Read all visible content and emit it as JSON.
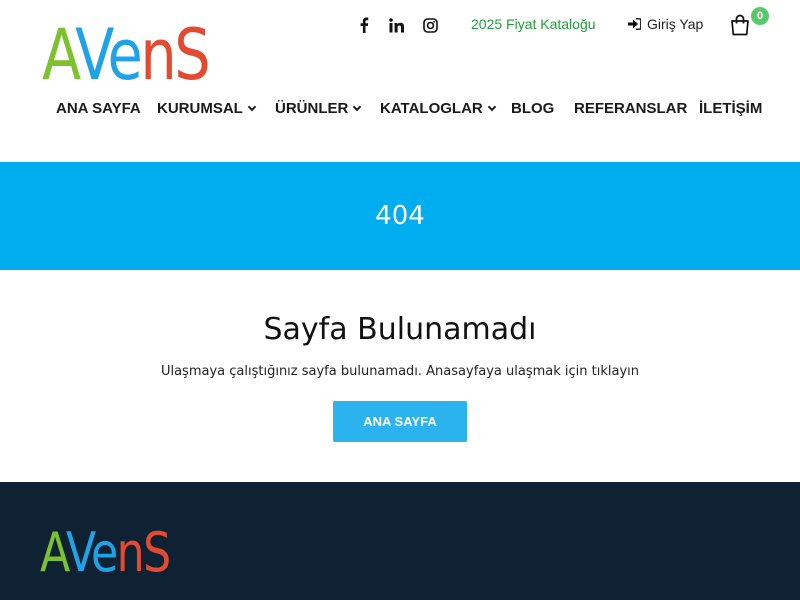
{
  "brand": {
    "logo_parts": [
      "A",
      "Ve",
      "nS"
    ],
    "colors": {
      "green": "#7dc22e",
      "blue": "#1fa3e6",
      "red": "#e44a2f"
    }
  },
  "topbar": {
    "social": [
      {
        "icon": "facebook-icon",
        "glyph": "f"
      },
      {
        "icon": "linkedin-icon",
        "glyph": "in"
      },
      {
        "icon": "instagram-icon",
        "glyph": ""
      }
    ],
    "catalog_link": "2025 Fiyat Kataloğu",
    "login_label": "Giriş Yap",
    "cart_count": "0"
  },
  "nav": {
    "items": [
      {
        "label": "ANA SAYFA",
        "has_dropdown": false
      },
      {
        "label": "KURUMSAL",
        "has_dropdown": true
      },
      {
        "label": "ÜRÜNLER",
        "has_dropdown": true
      },
      {
        "label": "KATALOGLAR",
        "has_dropdown": true
      },
      {
        "label": "BLOG",
        "has_dropdown": false
      },
      {
        "label": "REFERANSLAR",
        "has_dropdown": false
      },
      {
        "label": "İLETİŞİM",
        "has_dropdown": false
      }
    ]
  },
  "banner": {
    "title": "404",
    "color": "#00aeef"
  },
  "content": {
    "heading": "Sayfa Bulunamadı",
    "message": "Ulaşmaya çalıştığınız sayfa bulunamadı. Anasayfaya ulaşmak için tıklayın",
    "button_label": "ANA SAYFA"
  },
  "footer": {
    "background": "#0e2234"
  }
}
